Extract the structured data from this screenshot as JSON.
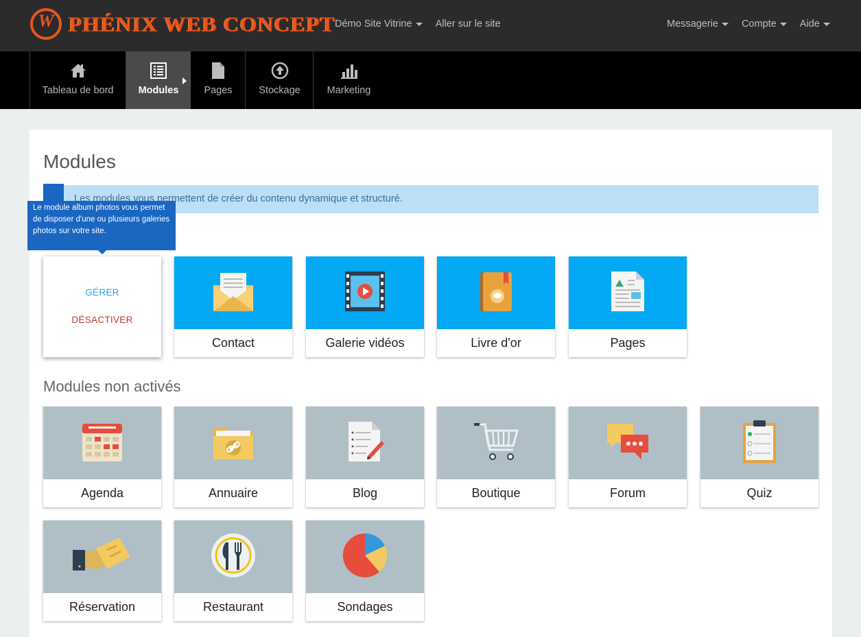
{
  "brand": {
    "logo_text": "PHÉNIX WEB CONCEPT",
    "accent": "#e8551e"
  },
  "topnav": {
    "site": "Démo Site Vitrine",
    "visit": "Aller sur le site",
    "messages": "Messagerie",
    "account": "Compte",
    "help": "Aide"
  },
  "tabs": [
    {
      "label": "Tableau de bord",
      "icon": "home-icon"
    },
    {
      "label": "Modules",
      "icon": "list-icon",
      "active": true
    },
    {
      "label": "Pages",
      "icon": "page-icon"
    },
    {
      "label": "Stockage",
      "icon": "upload-icon"
    },
    {
      "label": "Marketing",
      "icon": "bar-chart-icon"
    }
  ],
  "main": {
    "title": "Modules",
    "info": "Les modules vous permettent de créer du contenu dynamique et structuré.",
    "tooltip": "Le module album photos vous permet de disposer d'une ou plusieurs galeries photos sur votre site.",
    "menu": {
      "manage": "GÉRER",
      "deactivate": "DÉSACTIVER"
    },
    "active_modules": [
      {
        "label": "Contact",
        "icon": "envelope-icon"
      },
      {
        "label": "Galerie vidéos",
        "icon": "film-icon"
      },
      {
        "label": "Livre d'or",
        "icon": "guestbook-icon"
      },
      {
        "label": "Pages",
        "icon": "document-icon"
      }
    ],
    "inactive_title": "Modules non activés",
    "inactive_modules": [
      {
        "label": "Agenda",
        "icon": "calendar-icon"
      },
      {
        "label": "Annuaire",
        "icon": "folder-link-icon"
      },
      {
        "label": "Blog",
        "icon": "blog-icon"
      },
      {
        "label": "Boutique",
        "icon": "cart-icon"
      },
      {
        "label": "Forum",
        "icon": "chat-icon"
      },
      {
        "label": "Quiz",
        "icon": "clipboard-icon"
      },
      {
        "label": "Réservation",
        "icon": "ticket-icon"
      },
      {
        "label": "Restaurant",
        "icon": "cutlery-icon"
      },
      {
        "label": "Sondages",
        "icon": "pie-icon"
      }
    ]
  },
  "colors": {
    "active_tile": "#03a9f4",
    "inactive_tile": "#b0bec5",
    "info_bg": "#bcdff7",
    "tooltip_bg": "#1a66c0",
    "manage_link": "#2a9fd6",
    "deactivate_link": "#c0392b"
  }
}
